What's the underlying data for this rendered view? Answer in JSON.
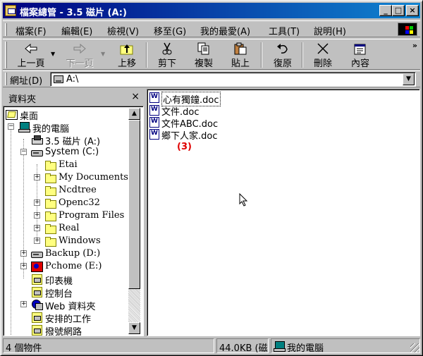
{
  "window": {
    "title": "檔案總管 - 3.5 磁片 (A:)",
    "minimize": "_",
    "maximize": "□",
    "close": "×"
  },
  "menu": [
    "檔案(F)",
    "編輯(E)",
    "檢視(V)",
    "移至(G)",
    "我的最愛(A)",
    "工具(T)",
    "說明(H)"
  ],
  "toolbar": {
    "back": "上一頁",
    "forward": "下一頁",
    "up": "上移",
    "cut": "剪下",
    "copy": "複製",
    "paste": "貼上",
    "undo": "復原",
    "delete": "刪除",
    "properties": "內容",
    "more": "»"
  },
  "address": {
    "label": "網址(D)",
    "value": "A:\\"
  },
  "folders_pane": {
    "title": "資料夾",
    "close": "×",
    "items": [
      {
        "label": "桌面",
        "icon": "desktop-icon"
      },
      {
        "label": "我的電腦",
        "icon": "computer-icon",
        "expander": "−"
      },
      {
        "label": "3.5 磁片 (A:)",
        "icon": "floppy-icon"
      },
      {
        "label": "System (C:)",
        "icon": "drive-icon",
        "expander": "−"
      },
      {
        "label": "Etai",
        "icon": "folder-icon"
      },
      {
        "label": "My Documents",
        "icon": "folder-icon",
        "expander": "+"
      },
      {
        "label": "Ncdtree",
        "icon": "folder-icon"
      },
      {
        "label": "Openc32",
        "icon": "folder-icon",
        "expander": "+"
      },
      {
        "label": "Program Files",
        "icon": "folder-icon",
        "expander": "+"
      },
      {
        "label": "Real",
        "icon": "folder-icon",
        "expander": "+"
      },
      {
        "label": "Windows",
        "icon": "folder-icon",
        "expander": "+"
      },
      {
        "label": "Backup (D:)",
        "icon": "drive-icon",
        "expander": "+"
      },
      {
        "label": "Pchome (E:)",
        "icon": "pchome-icon",
        "expander": "+"
      },
      {
        "label": "印表機",
        "icon": "printer-icon"
      },
      {
        "label": "控制台",
        "icon": "control-panel-icon"
      },
      {
        "label": "Web 資料夾",
        "icon": "web-folder-icon",
        "expander": "+"
      },
      {
        "label": "安排的工作",
        "icon": "scheduled-tasks-icon"
      },
      {
        "label": "撥號網路",
        "icon": "dialup-icon"
      }
    ]
  },
  "files": [
    {
      "name": "心有獨鐘.doc",
      "focused": true
    },
    {
      "name": "文件.doc"
    },
    {
      "name": "文件ABC.doc"
    },
    {
      "name": "鄉下人家.doc"
    }
  ],
  "annotation": "(3)",
  "status": {
    "objects": "4 個物件",
    "size": "44.0KB (磁",
    "location": "我的電腦"
  }
}
